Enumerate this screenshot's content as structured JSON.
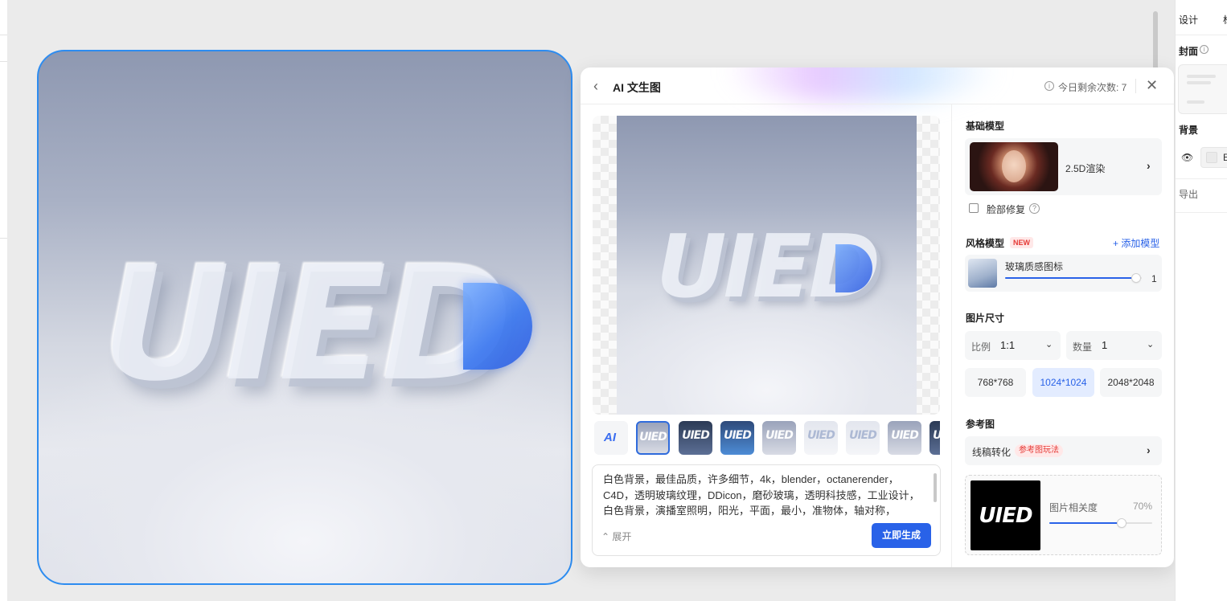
{
  "canvas": {
    "art_text": "UIED"
  },
  "ai_panel": {
    "title": "AI 文生图",
    "quota": "今日剩余次数: 7",
    "preview_text": "UIED",
    "thumbnails": [
      "UIED",
      "UIED",
      "UIED",
      "UIED",
      "UIED",
      "UIED",
      "UIED",
      "UIED"
    ],
    "ai_thumb_text": "AI",
    "prompt": "白色背景，最佳品质，许多细节，4k，blender，octanerender，C4D，透明玻璃纹理，DDicon，磨砂玻璃，透明科技感，工业设计，白色背景，演播室照明，阳光，平面，最小，准物体，轴对称，",
    "expand_label": "展开",
    "generate_label": "立即生成",
    "base_model": {
      "section_title": "基础模型",
      "name": "2.5D渲染",
      "face_fix_label": "脸部修复",
      "face_fix_checked": false
    },
    "style_model": {
      "section_title": "风格模型",
      "new_badge": "NEW",
      "add_label": "+ 添加模型",
      "item_name": "玻璃质感图标",
      "item_weight": "1",
      "item_weight_fraction": 0.96
    },
    "image_size": {
      "section_title": "图片尺寸",
      "ratio_label": "比例",
      "ratio_value": "1:1",
      "count_label": "数量",
      "count_value": "1",
      "options": [
        "768*768",
        "1024*1024",
        "2048*2048"
      ],
      "selected": "1024*1024"
    },
    "reference": {
      "section_title": "参考图",
      "mode": "线稿转化",
      "mode_badge": "参考图玩法",
      "image_text": "UIED",
      "relevance_label": "图片相关度",
      "relevance_value": "70%",
      "relevance_fraction": 0.7
    }
  },
  "properties_panel": {
    "tabs": [
      "设计",
      "标"
    ],
    "cover_label": "封面",
    "background_label": "背景",
    "background_value": "E",
    "export_label": "导出"
  },
  "colors": {
    "accent": "#2962e8",
    "canvas_selection": "#2d8cf0",
    "badge_red": "#e53935"
  },
  "icons": [
    "back-chevron-icon",
    "info-icon",
    "close-icon",
    "chevron-right-icon",
    "help-icon",
    "chevron-down-icon",
    "expand-icon",
    "eye-icon"
  ]
}
